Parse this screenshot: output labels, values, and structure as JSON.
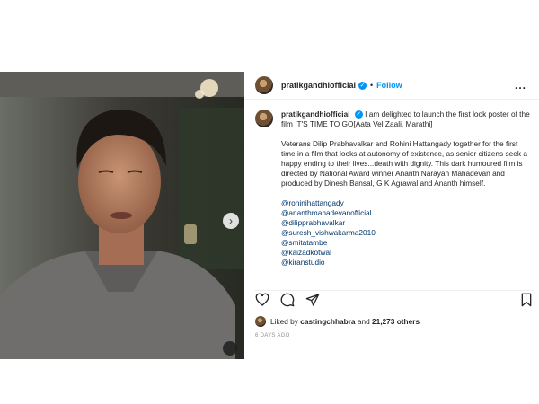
{
  "post": {
    "header": {
      "username": "pratikgandhiofficial",
      "separator": "•",
      "follow_label": "Follow",
      "more_label": "..."
    },
    "caption": {
      "username": "pratikgandhiofficial",
      "intro": "I am delighted to launch the first look poster of the film IT'S TIME TO GO[Aata Vel Zaali, Marathi]",
      "body": "Veterans Dilip Prabhavalkar and Rohini Hattangady  together for the first time in a film that looks at  autonomy of existence, as senior citizens seek a happy ending to their lives...death with dignity. This dark humoured film is directed by National Award winner Ananth Narayan Mahadevan and produced by Dinesh Bansal, G K Agrawal and Ananth himself.",
      "mentions": [
        "@rohinihattangady",
        "@ananthmahadevanofficial",
        "@dilipprabhavalkar",
        "@suresh_vishwakarma2010",
        "@smitatambe",
        "@kaizadkotwal",
        "@kiranstudio"
      ]
    },
    "likes": {
      "prefix": "Liked by",
      "user": "castingchhabra",
      "middle": "and",
      "count": "21,273 others"
    },
    "timestamp": "6 DAYS AGO",
    "media": {
      "next_icon": "›"
    }
  },
  "colors": {
    "accent": "#0095f6",
    "mention": "#00376b",
    "muted": "#8e8e8e"
  }
}
